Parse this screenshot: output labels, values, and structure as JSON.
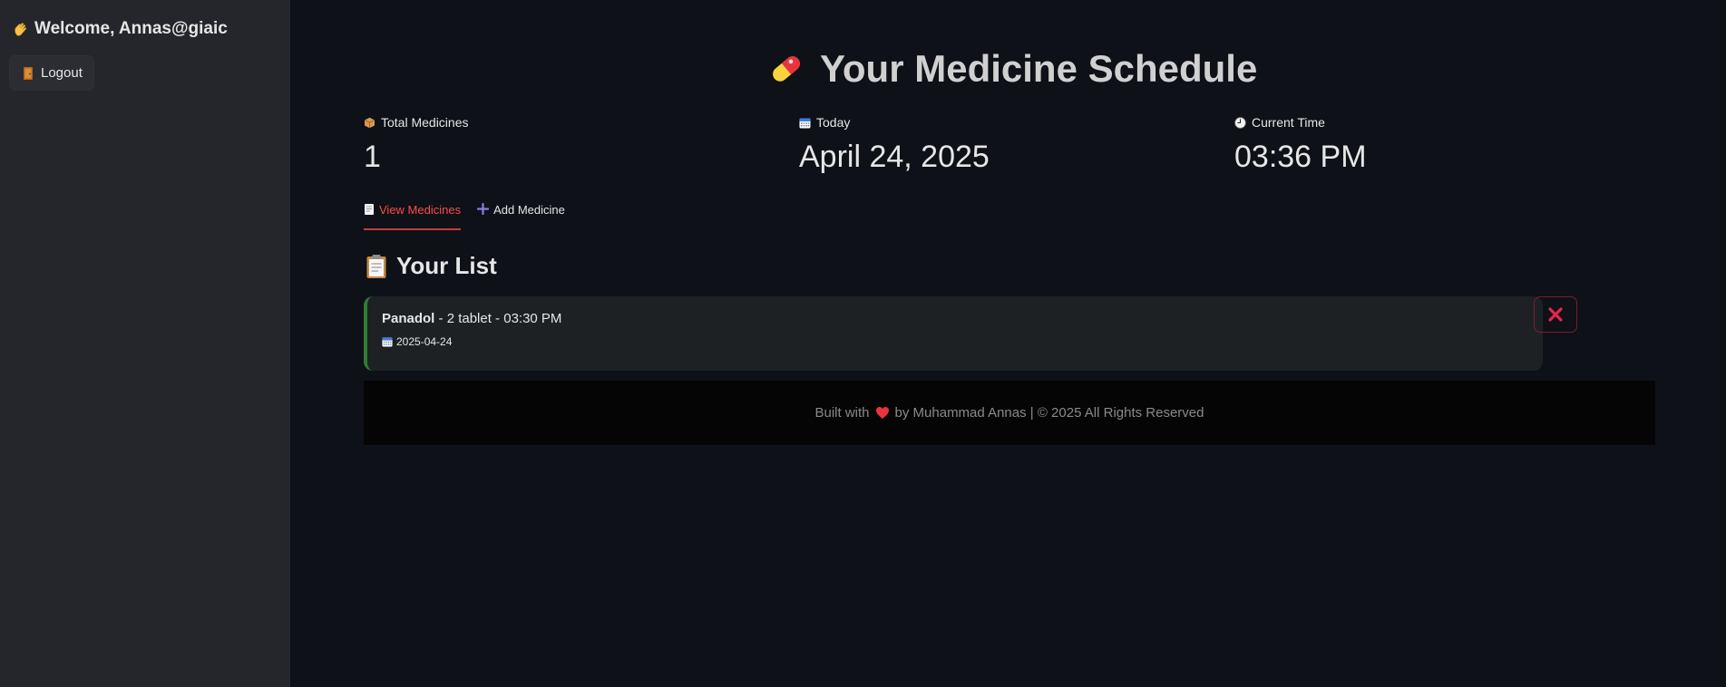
{
  "sidebar": {
    "welcome_text": "Welcome, Annas@giaic",
    "welcome_icon": "waving-hand-icon",
    "logout_label": "Logout",
    "logout_icon": "door-icon"
  },
  "main": {
    "title": "Your Medicine Schedule",
    "title_icon": "pill-icon",
    "metrics": [
      {
        "icon": "package-icon",
        "label": "Total Medicines",
        "value": "1"
      },
      {
        "icon": "calendar-icon",
        "label": "Today",
        "value": "April 24, 2025"
      },
      {
        "icon": "clock-icon",
        "label": "Current Time",
        "value": "03:36 PM"
      }
    ],
    "tabs": [
      {
        "icon": "memo-icon",
        "label": "View Medicines",
        "active": true
      },
      {
        "icon": "plus-icon",
        "label": "Add Medicine",
        "active": false
      }
    ],
    "list_heading": "Your List",
    "list_heading_icon": "clipboard-icon",
    "medicines": [
      {
        "name": "Panadol",
        "details": " - 2 tablet - 03:30 PM",
        "date": "2025-04-24",
        "date_icon": "calendar-icon",
        "delete_icon": "close-icon"
      }
    ]
  },
  "footer": {
    "prefix": "Built with",
    "heart_icon": "heart-icon",
    "suffix": "by Muhammad Annas | © 2025 All Rights Reserved"
  },
  "colors": {
    "background": "#0e1117",
    "sidebar": "#24262b",
    "accent_red": "#ff4b4b",
    "card_border_green": "#2e7d32",
    "delete_border": "#7a1f2b"
  }
}
